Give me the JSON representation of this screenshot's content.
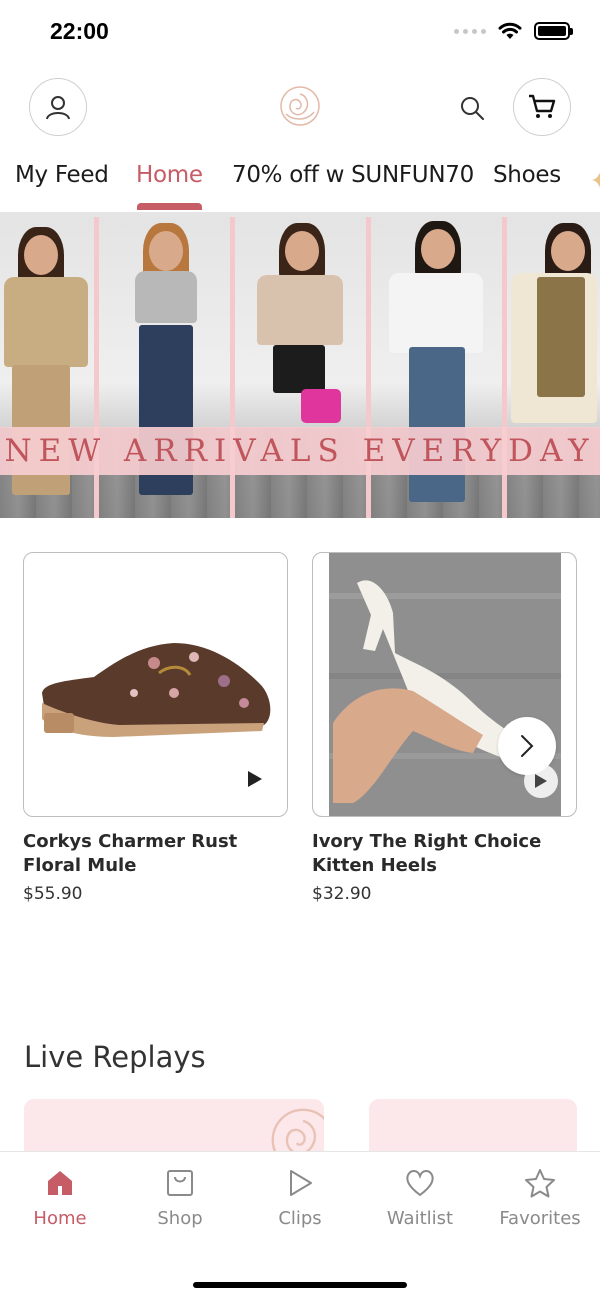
{
  "status_bar": {
    "time": "22:00"
  },
  "header": {
    "account_icon": "person-icon",
    "logo_icon": "rose-logo",
    "search_icon": "search-icon",
    "cart_icon": "cart-icon"
  },
  "tabs": [
    {
      "label": "My Feed",
      "active": false
    },
    {
      "label": "Home",
      "active": true
    },
    {
      "label": "70% off w SUNFUN70",
      "active": false
    },
    {
      "label": "Shoes",
      "active": false
    }
  ],
  "banner": {
    "text": "NEW ARRIVALS EVERYDAY"
  },
  "products": [
    {
      "title": "Corkys Charmer Rust Floral Mule",
      "price": "$55.90"
    },
    {
      "title": "Ivory The Right Choice Kitten Heels",
      "price": "$32.90"
    }
  ],
  "live_replays": {
    "title": "Live Replays"
  },
  "tabbar": [
    {
      "label": "Home",
      "icon": "home-icon",
      "active": true
    },
    {
      "label": "Shop",
      "icon": "bag-icon",
      "active": false
    },
    {
      "label": "Clips",
      "icon": "play-icon",
      "active": false
    },
    {
      "label": "Waitlist",
      "icon": "heart-icon",
      "active": false
    },
    {
      "label": "Favorites",
      "icon": "star-icon",
      "active": false
    }
  ],
  "colors": {
    "accent": "#c65c66",
    "banner_pink": "#f5c9cc",
    "replay_pink": "#fce8ea"
  }
}
